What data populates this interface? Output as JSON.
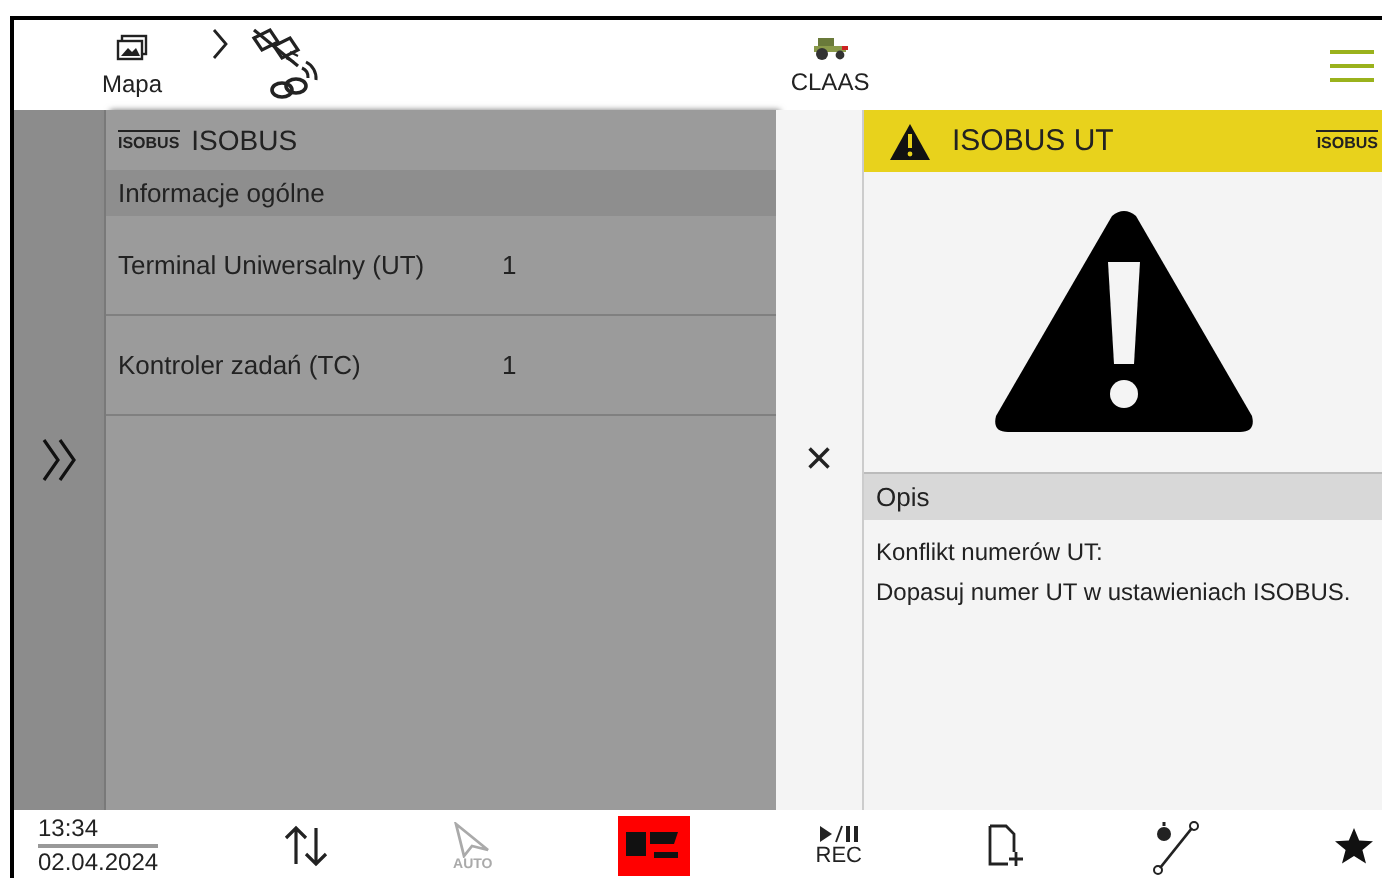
{
  "header": {
    "map_label": "Mapa",
    "brand_label": "CLAAS"
  },
  "left_panel": {
    "logo_text": "ISOBUS",
    "title": "ISOBUS",
    "section": "Informacje ogólne",
    "rows": [
      {
        "label": "Terminal Uniwersalny (UT)",
        "value": "1"
      },
      {
        "label": "Kontroler zadań (TC)",
        "value": "1"
      }
    ]
  },
  "close_button": "×",
  "detail": {
    "title": "ISOBUS UT",
    "logo_text": "ISOBUS",
    "section": "Opis",
    "lines": [
      "Konflikt numerów UT:",
      "Dopasuj numer UT w ustawieniach ISOBUS."
    ]
  },
  "status_bar": {
    "time": "13:34",
    "date": "02.04.2024",
    "auto_label": "AUTO",
    "rec_label": "REC"
  }
}
